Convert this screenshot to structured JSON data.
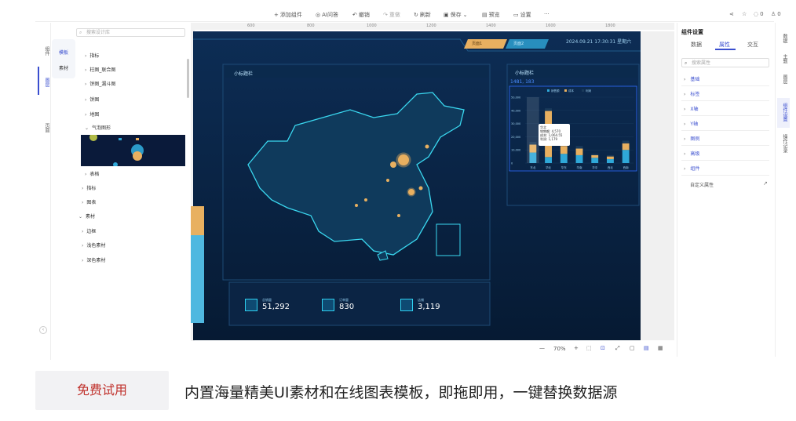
{
  "toolbar": {
    "items": [
      "添加组件",
      "AI问答",
      "撤销",
      "重做",
      "刷新",
      "保存",
      "预览",
      "设置"
    ],
    "more": "···",
    "right": {
      "comments": "0",
      "likes": "0"
    }
  },
  "left_rail": {
    "items": [
      "组件",
      "图层",
      "页面"
    ]
  },
  "left_tabs": {
    "items": [
      "模板",
      "素材"
    ]
  },
  "tree": {
    "search_placeholder": "搜索设计库",
    "nodes": [
      {
        "label": "指标",
        "indent": 2
      },
      {
        "label": "柱图_联合图",
        "indent": 2
      },
      {
        "label": "饼图_漏斗图",
        "indent": 2
      },
      {
        "label": "饼图",
        "indent": 2
      },
      {
        "label": "地图",
        "indent": 2
      },
      {
        "label": "气泡图形",
        "indent": 2,
        "open": true
      },
      {
        "label": "表格",
        "indent": 2
      },
      {
        "label": "指标",
        "indent": 1
      },
      {
        "label": "图表",
        "indent": 1
      },
      {
        "label": "素材",
        "indent": 0,
        "open": true
      },
      {
        "label": "边框",
        "indent": 1
      },
      {
        "label": "浅色素材",
        "indent": 1
      },
      {
        "label": "深色素材",
        "indent": 1
      }
    ]
  },
  "ruler": {
    "ticks": [
      "600",
      "800",
      "1000",
      "1200",
      "1400",
      "1600",
      "1800"
    ]
  },
  "canvas": {
    "top_tabs": [
      "页面1",
      "页面2"
    ],
    "datetime": "2024.09.21 17:30:31 星期六",
    "map_title": "小标题栏",
    "chart_title": "小标题栏",
    "coord_readout": "1481, 183",
    "kpis": [
      {
        "label": "总销量",
        "value": "51,292"
      },
      {
        "label": "订单量",
        "value": "830"
      },
      {
        "label": "店铺",
        "value": "3,119"
      }
    ],
    "tooltip": {
      "title": "华北",
      "lines": [
        "销售额: 4,570",
        "成本: 1,064.55",
        "利润: 1,179"
      ]
    }
  },
  "chart_data": {
    "type": "bar",
    "categories": [
      "东北",
      "华北",
      "华东",
      "华南",
      "华中",
      "西北",
      "西南"
    ],
    "series": [
      {
        "name": "销售额",
        "values": [
          8000,
          4570,
          7000,
          6000,
          4000,
          3000,
          10000
        ],
        "color": "#2fa8d8"
      },
      {
        "name": "成本",
        "values": [
          6000,
          35000,
          6000,
          5000,
          2000,
          2000,
          5000
        ],
        "color": "#e8b060"
      },
      {
        "name": "利润",
        "values": [
          2000,
          2000,
          2000,
          2000,
          1000,
          1000,
          2000
        ],
        "color": "#1a3a5a"
      }
    ],
    "ylim": [
      0,
      50000
    ],
    "yticks": [
      "50,000",
      "40,000",
      "30,000",
      "20,000",
      "10,000",
      "0"
    ]
  },
  "bottombar": {
    "zoom": "70%"
  },
  "right_panel": {
    "title": "组件设置",
    "tabs": [
      "数据",
      "属性",
      "交互"
    ],
    "active_tab": "属性",
    "search_placeholder": "搜索属性",
    "items": [
      "基础",
      "标签",
      "X轴",
      "Y轴",
      "图例",
      "高级",
      "组件"
    ],
    "custom": "自定义属性"
  },
  "right_rail": {
    "items": [
      "数据",
      "主题",
      "图层",
      "组件设置",
      "操作记录"
    ]
  },
  "footer": {
    "button": "免费试用",
    "slogan": "内置海量精美UI素材和在线图表模板，即拖即用，一键替换数据源"
  },
  "colors": {
    "accent": "#3a4ecf",
    "canvas_bg": "#061a33",
    "cyan": "#2fd0f0",
    "gold": "#e8b060"
  }
}
